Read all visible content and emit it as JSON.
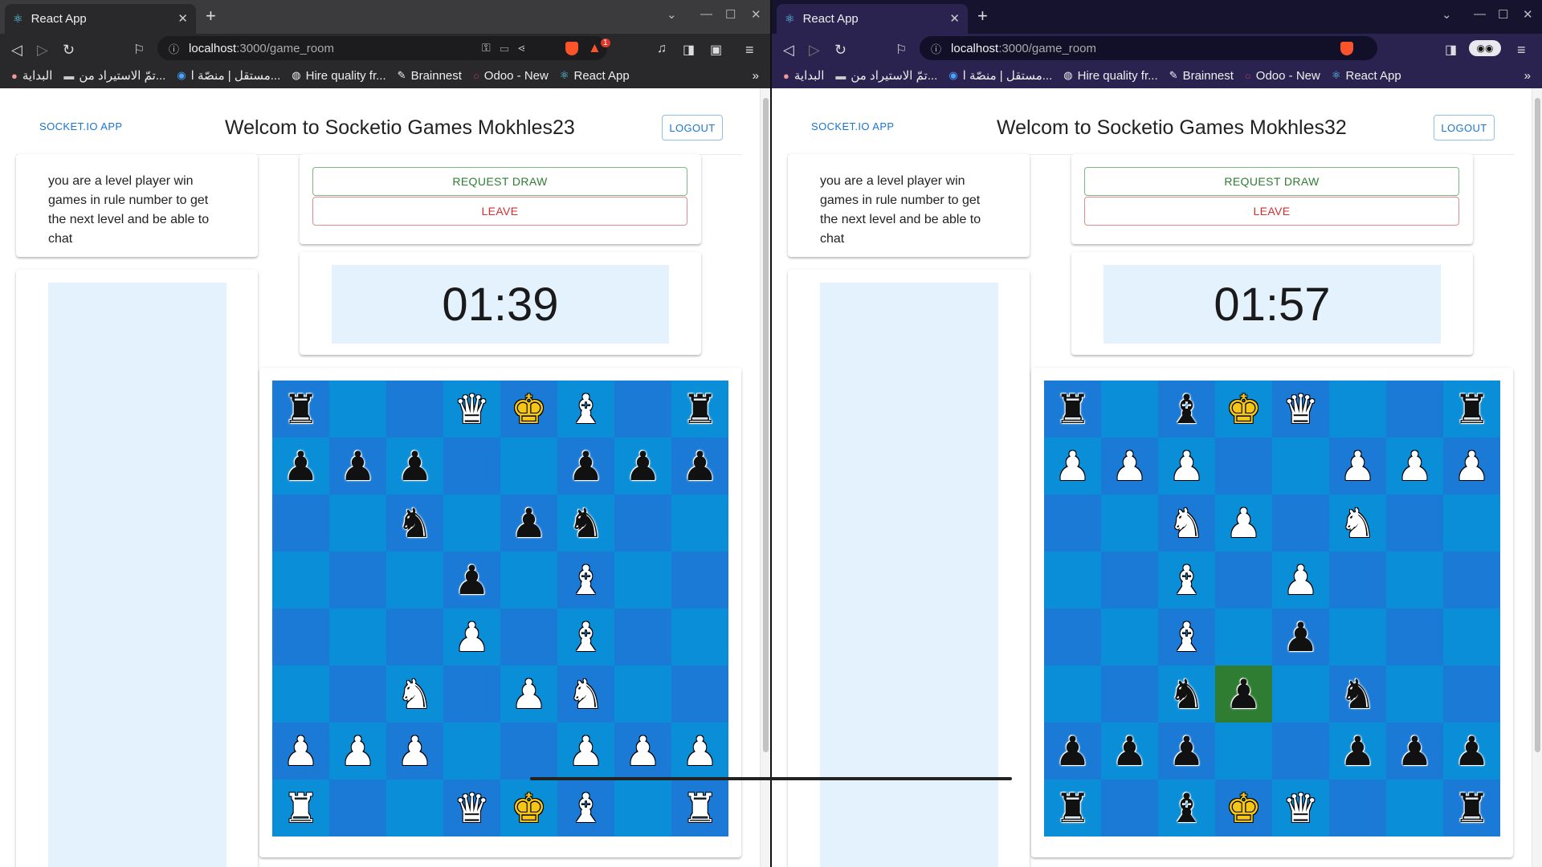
{
  "windows": [
    {
      "tab_title": "React App",
      "url_host": "localhost",
      "url_path": ":3000/game_room",
      "brand": "SOCKET.IO APP",
      "welcome": "Welcom to Socketio Games Mokhles23",
      "logout_label": "LOGOUT",
      "info_text": "you are a level player win games in rule number to get the next level and be able to chat",
      "request_draw_label": "REQUEST DRAW",
      "leave_label": "LEAVE",
      "timer": "01:39",
      "notification_count": "1",
      "board": [
        [
          "bR",
          "",
          "",
          "wQ",
          "gK",
          "wB",
          "",
          "bR"
        ],
        [
          "bP",
          "bP",
          "bP",
          "",
          "",
          "bP",
          "bP",
          "bP"
        ],
        [
          "",
          "",
          "bN",
          "",
          "bP",
          "bN",
          "",
          ""
        ],
        [
          "",
          "",
          "",
          "bP",
          "",
          "wB",
          "",
          ""
        ],
        [
          "",
          "",
          "",
          "wP",
          "",
          "wB",
          "",
          ""
        ],
        [
          "",
          "",
          "wN",
          "",
          "wP",
          "wN",
          "",
          ""
        ],
        [
          "wP",
          "wP",
          "wP",
          "",
          "",
          "wP",
          "wP",
          "wP"
        ],
        [
          "wR",
          "",
          "",
          "wQ",
          "gK",
          "wB",
          "",
          "wR"
        ]
      ],
      "highlight": []
    },
    {
      "tab_title": "React App",
      "url_host": "localhost",
      "url_path": ":3000/game_room",
      "brand": "SOCKET.IO APP",
      "welcome": "Welcom to Socketio Games Mokhles32",
      "logout_label": "LOGOUT",
      "info_text": "you are a level player win games in rule number to get the next level and be able to chat",
      "request_draw_label": "REQUEST DRAW",
      "leave_label": "LEAVE",
      "timer": "01:57",
      "board": [
        [
          "bR",
          "",
          "bB",
          "gK",
          "wQ",
          "",
          "",
          "bR"
        ],
        [
          "wP",
          "wP",
          "wP",
          "",
          "",
          "wP",
          "wP",
          "wP"
        ],
        [
          "",
          "",
          "wN",
          "wP",
          "",
          "wN",
          "",
          ""
        ],
        [
          "",
          "",
          "wB",
          "",
          "wP",
          "",
          "",
          ""
        ],
        [
          "",
          "",
          "wB",
          "",
          "bP",
          "",
          "",
          ""
        ],
        [
          "",
          "",
          "bN",
          "bP",
          "",
          "bN",
          "",
          ""
        ],
        [
          "bP",
          "bP",
          "bP",
          "",
          "",
          "bP",
          "bP",
          "bP"
        ],
        [
          "bR",
          "",
          "bB",
          "gK",
          "wQ",
          "",
          "",
          "bR"
        ]
      ],
      "highlight": [
        [
          5,
          3
        ]
      ]
    }
  ],
  "bookmarks": [
    "البداية",
    "تمّ الاستيراد من...",
    "مستقل | منصّة ا...",
    "Hire quality fr...",
    "Brainnest",
    "Odoo - New",
    "React App"
  ],
  "glyphs": {
    "K": "♚",
    "Q": "♛",
    "R": "♜",
    "B": "♝",
    "N": "♞",
    "P": "♟"
  },
  "icons": [
    "react-favicon-icon",
    "close-icon",
    "new-tab-icon",
    "back-icon",
    "forward-icon",
    "reload-icon",
    "bookmark-icon",
    "info-icon",
    "brave-shield-icon",
    "sidebar-icon",
    "menu-icon"
  ]
}
